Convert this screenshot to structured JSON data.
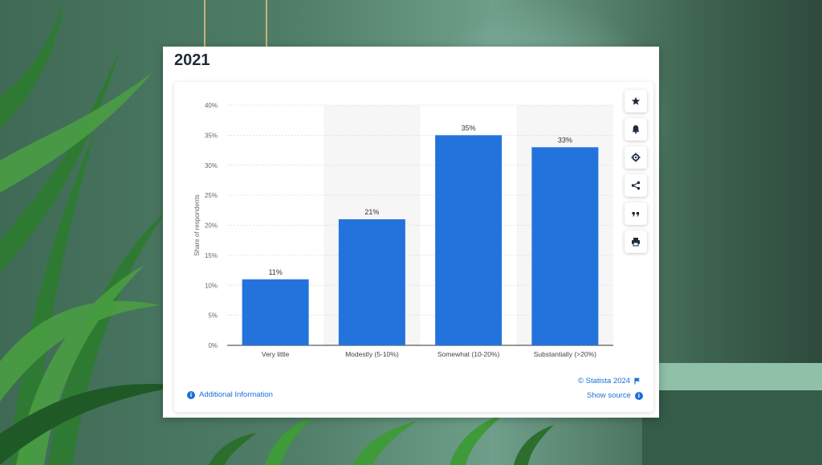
{
  "page": {
    "year_title": "2021",
    "additional_info_label": "Additional Information",
    "copyright_label": "© Statista 2024",
    "show_source_label": "Show source"
  },
  "toolbar": {
    "icons": [
      "star-icon",
      "bell-icon",
      "gear-icon",
      "share-icon",
      "quote-icon",
      "print-icon"
    ]
  },
  "colors": {
    "bar": "#2473dc",
    "link": "#1a6fd8"
  },
  "chart_data": {
    "type": "bar",
    "categories": [
      "Very little",
      "Modestly (5-10%)",
      "Somewhat (10-20%)",
      "Substantially (>20%)"
    ],
    "values": [
      11,
      21,
      35,
      33
    ],
    "data_labels": [
      "11%",
      "21%",
      "35%",
      "33%"
    ],
    "ylabel": "Share of respondents",
    "ylim": [
      0,
      40
    ],
    "yticks": [
      "0%",
      "5%",
      "10%",
      "15%",
      "20%",
      "25%",
      "30%",
      "35%",
      "40%"
    ],
    "grid": true
  }
}
